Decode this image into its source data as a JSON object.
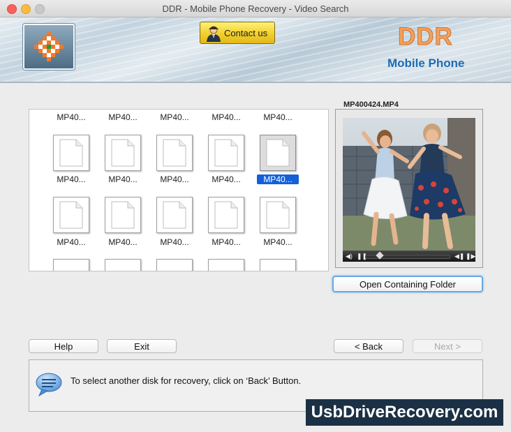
{
  "window": {
    "title": "DDR - Mobile Phone Recovery - Video Search"
  },
  "header": {
    "contact_label": "Contact us",
    "brand": "DDR",
    "brand_sub": "Mobile Phone",
    "brand_color": "#f3a15c",
    "accent_color": "#1f6bb5"
  },
  "files": {
    "rows": [
      [
        "MP40...",
        "MP40...",
        "MP40...",
        "MP40...",
        "MP40..."
      ],
      [
        "MP40...",
        "MP40...",
        "MP40...",
        "MP40...",
        "MP40..."
      ],
      [
        "MP40...",
        "MP40...",
        "MP40...",
        "MP40...",
        "MP40..."
      ]
    ],
    "selected": {
      "row": 1,
      "col": 4
    },
    "selection_color": "#1360d8"
  },
  "preview": {
    "filename": "MP400424.MP4",
    "open_folder_label": "Open Containing Folder"
  },
  "buttons": {
    "help": "Help",
    "exit": "Exit",
    "back": "< Back",
    "next": "Next >"
  },
  "message": {
    "text": "To select another disk for recovery, click on ‘Back’ Button."
  },
  "watermark": "UsbDriveRecovery.com"
}
